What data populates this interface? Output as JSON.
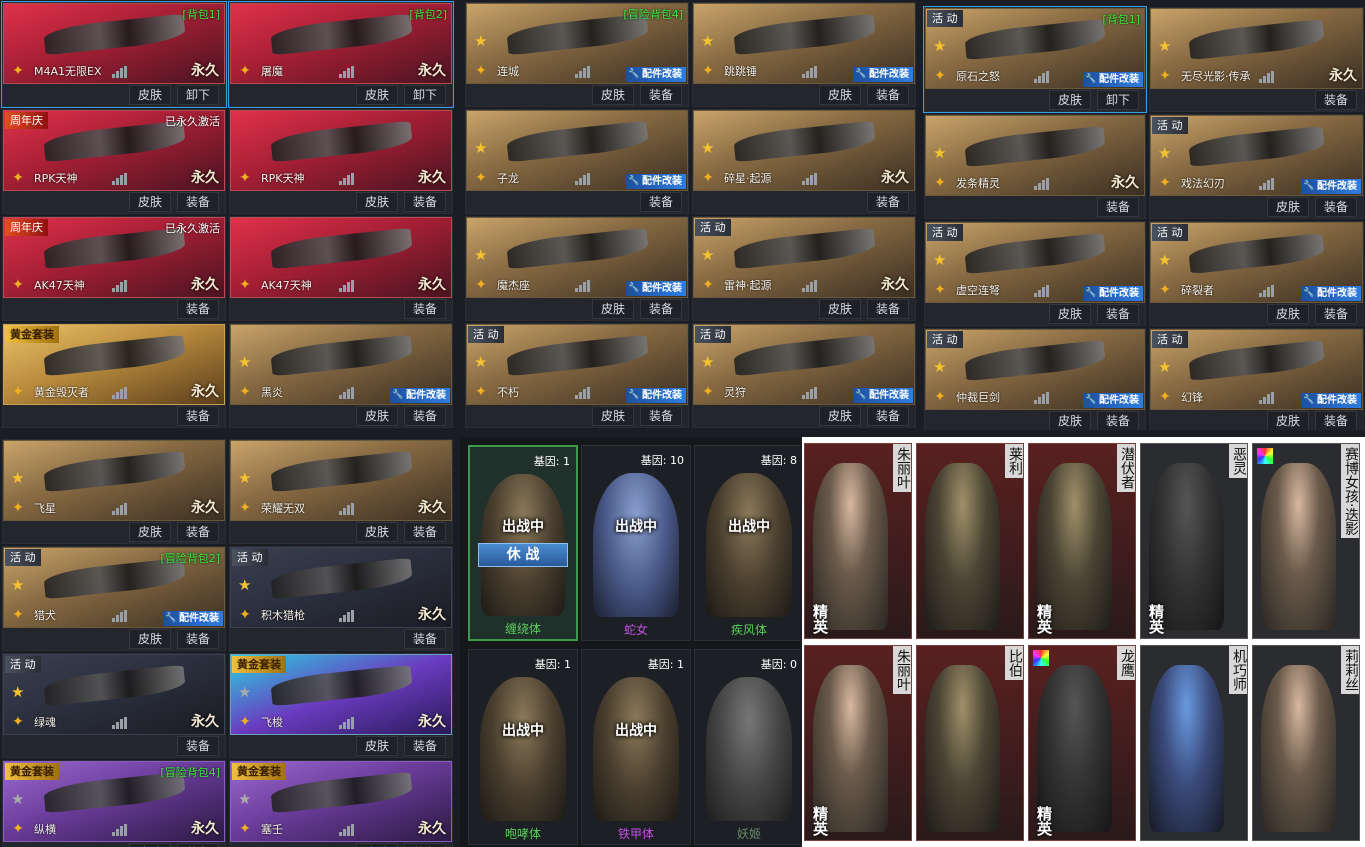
{
  "panel_a": {
    "cards": [
      {
        "name": "M4A1无限EX",
        "tr": "[背包1]",
        "tr_white": false,
        "tl": "",
        "theme": "red",
        "star": false,
        "perm": "永久",
        "mod": false,
        "btns": [
          "皮肤",
          "卸下"
        ],
        "sel": true
      },
      {
        "name": "屠魔",
        "tr": "[背包2]",
        "tr_white": false,
        "tl": "",
        "theme": "red",
        "star": false,
        "perm": "永久",
        "mod": false,
        "btns": [
          "皮肤",
          "卸下"
        ],
        "sel": true
      },
      {
        "name": "RPK天神",
        "tr": "已永久激活",
        "tr_white": true,
        "tl": "周年庆",
        "tl_kind": "anniv",
        "theme": "red",
        "star": false,
        "perm": "永久",
        "mod": false,
        "btns": [
          "皮肤",
          "装备"
        ]
      },
      {
        "name": "RPK天神",
        "tr": "",
        "tl": "",
        "theme": "red",
        "star": false,
        "perm": "永久",
        "mod": false,
        "btns": [
          "皮肤",
          "装备"
        ]
      },
      {
        "name": "AK47天神",
        "tr": "已永久激活",
        "tr_white": true,
        "tl": "周年庆",
        "tl_kind": "anniv",
        "theme": "red",
        "star": false,
        "perm": "永久",
        "mod": false,
        "btns": [
          "装备"
        ]
      },
      {
        "name": "AK47天神",
        "tr": "",
        "tl": "",
        "theme": "red",
        "star": false,
        "perm": "永久",
        "mod": false,
        "btns": [
          "装备"
        ]
      },
      {
        "name": "黄金毁灭者",
        "tr": "",
        "tl": "黄金套装",
        "tl_kind": "gold",
        "theme": "gold",
        "star": false,
        "perm": "永久",
        "mod": false,
        "btns": [
          "装备"
        ]
      },
      {
        "name": "黑炎",
        "tr": "",
        "tl": "",
        "theme": "",
        "star": true,
        "perm": "",
        "mod": true,
        "btns": [
          "皮肤",
          "装备"
        ]
      }
    ]
  },
  "panel_b": {
    "cards": [
      {
        "name": "连城",
        "tr": "[冒险背包4]",
        "tl": "",
        "theme": "",
        "star": true,
        "perm": "",
        "mod": true,
        "btns": [
          "皮肤",
          "装备"
        ]
      },
      {
        "name": "跳跳锤",
        "tr": "",
        "tl": "",
        "theme": "",
        "star": true,
        "perm": "",
        "mod": true,
        "btns": [
          "皮肤",
          "装备"
        ]
      },
      {
        "name": "子龙",
        "tr": "",
        "tl": "",
        "theme": "",
        "star": true,
        "perm": "",
        "mod": true,
        "btns": [
          "装备"
        ]
      },
      {
        "name": "碎星·起源",
        "tr": "",
        "tl": "",
        "theme": "",
        "star": true,
        "perm": "永久",
        "mod": false,
        "btns": [
          "装备"
        ]
      },
      {
        "name": "魔杰座",
        "tr": "",
        "tl": "",
        "theme": "",
        "star": true,
        "perm": "",
        "mod": true,
        "btns": [
          "皮肤",
          "装备"
        ]
      },
      {
        "name": "雷神·起源",
        "tr": "",
        "tl": "活 动",
        "tl_kind": "event",
        "theme": "",
        "star": true,
        "perm": "永久",
        "mod": false,
        "btns": [
          "皮肤",
          "装备"
        ]
      },
      {
        "name": "不朽",
        "tr": "",
        "tl": "活 动",
        "tl_kind": "event",
        "theme": "",
        "star": true,
        "perm": "",
        "mod": true,
        "btns": [
          "皮肤",
          "装备"
        ]
      },
      {
        "name": "灵狩",
        "tr": "",
        "tl": "活 动",
        "tl_kind": "event",
        "theme": "",
        "star": true,
        "perm": "",
        "mod": true,
        "btns": [
          "皮肤",
          "装备"
        ]
      }
    ]
  },
  "panel_c": {
    "cards": [
      {
        "name": "原石之怒",
        "tr": "[背包1]",
        "tl": "活 动",
        "tl_kind": "event",
        "theme": "",
        "star": true,
        "perm": "",
        "mod": true,
        "btns": [
          "皮肤",
          "卸下"
        ],
        "sel": true
      },
      {
        "name": "无尽光影·传承",
        "tr": "",
        "tl": "",
        "theme": "",
        "star": true,
        "perm": "永久",
        "mod": false,
        "btns": [
          "装备"
        ]
      },
      {
        "name": "发条精灵",
        "tr": "",
        "tl": "",
        "theme": "",
        "star": true,
        "perm": "永久",
        "mod": false,
        "btns": [
          "装备"
        ]
      },
      {
        "name": "戏法幻刃",
        "tr": "",
        "tl": "活 动",
        "tl_kind": "event",
        "theme": "",
        "star": true,
        "perm": "",
        "mod": true,
        "btns": [
          "皮肤",
          "装备"
        ]
      },
      {
        "name": "虚空连弩",
        "tr": "",
        "tl": "活 动",
        "tl_kind": "event",
        "theme": "",
        "star": true,
        "perm": "",
        "mod": true,
        "btns": [
          "皮肤",
          "装备"
        ]
      },
      {
        "name": "碎裂者",
        "tr": "",
        "tl": "活 动",
        "tl_kind": "event",
        "theme": "",
        "star": true,
        "perm": "",
        "mod": true,
        "btns": [
          "皮肤",
          "装备"
        ]
      },
      {
        "name": "仲裁巨剑",
        "tr": "",
        "tl": "活 动",
        "tl_kind": "event",
        "theme": "",
        "star": true,
        "perm": "",
        "mod": true,
        "btns": [
          "皮肤",
          "装备"
        ]
      },
      {
        "name": "幻锋",
        "tr": "",
        "tl": "活 动",
        "tl_kind": "event",
        "theme": "",
        "star": true,
        "perm": "",
        "mod": true,
        "btns": [
          "皮肤",
          "装备"
        ]
      }
    ]
  },
  "panel_d": {
    "cards": [
      {
        "name": "飞星",
        "tr": "",
        "tl": "",
        "theme": "",
        "star": true,
        "perm": "永久",
        "mod": false,
        "btns": [
          "皮肤",
          "装备"
        ]
      },
      {
        "name": "荣耀无双",
        "tr": "",
        "tl": "",
        "theme": "",
        "star": true,
        "perm": "永久",
        "mod": false,
        "btns": [
          "皮肤",
          "装备"
        ]
      },
      {
        "name": "猎犬",
        "tr": "[冒险背包2]",
        "tl": "活 动",
        "tl_kind": "event",
        "theme": "",
        "star": true,
        "perm": "",
        "mod": true,
        "btns": [
          "皮肤",
          "装备"
        ]
      },
      {
        "name": "积木猎枪",
        "tr": "",
        "tl": "活 动",
        "tl_kind": "event",
        "theme": "dark",
        "star": true,
        "perm": "永久",
        "mod": false,
        "btns": [
          "装备"
        ]
      },
      {
        "name": "绿魂",
        "tr": "",
        "tl": "活 动",
        "tl_kind": "event",
        "theme": "dark",
        "star": true,
        "perm": "永久",
        "mod": false,
        "btns": [
          "装备"
        ]
      },
      {
        "name": "飞梭",
        "tr": "",
        "tl": "黄金套装",
        "tl_kind": "gold",
        "theme": "cyan",
        "star": true,
        "star_grey": true,
        "perm": "永久",
        "mod": false,
        "btns": [
          "皮肤",
          "装备"
        ]
      },
      {
        "name": "纵横",
        "tr": "[冒险背包4]",
        "tl": "黄金套装",
        "tl_kind": "gold",
        "theme": "purple",
        "star": true,
        "star_grey": true,
        "perm": "永久",
        "mod": false,
        "btns": [
          "皮肤",
          "装备"
        ]
      },
      {
        "name": "塞壬",
        "tr": "",
        "tl": "黄金套装",
        "tl_kind": "gold",
        "theme": "purple",
        "star": true,
        "star_grey": true,
        "perm": "永久",
        "mod": false,
        "btns": [
          "皮肤",
          "装备"
        ]
      }
    ]
  },
  "zombies": [
    {
      "name": "缠绕体",
      "gene": "基因: 1",
      "battle": "出战中",
      "rest": "休 战",
      "active": true,
      "fig": "",
      "name_color": ""
    },
    {
      "name": "蛇女",
      "gene": "基因: 10",
      "battle": "出战中",
      "rest": "",
      "active": false,
      "fig": "blue",
      "name_color": "purple"
    },
    {
      "name": "疾风体",
      "gene": "基因: 8",
      "battle": "出战中",
      "rest": "",
      "active": false,
      "fig": "",
      "name_color": ""
    },
    {
      "name": "咆哮体",
      "gene": "基因: 1",
      "battle": "出战中",
      "rest": "",
      "active": false,
      "fig": "",
      "name_color": ""
    },
    {
      "name": "铁甲体",
      "gene": "基因: 1",
      "battle": "出战中",
      "rest": "",
      "active": false,
      "fig": "",
      "name_color": "purple"
    },
    {
      "name": "妖姬",
      "gene": "基因: 0",
      "battle": "",
      "rest": "",
      "active": false,
      "fig": "grey",
      "name_color": "dim"
    }
  ],
  "characters": [
    {
      "name": "朱丽叶",
      "elite": "精英",
      "rainbow": false,
      "fig": "",
      "red": true
    },
    {
      "name": "莱利",
      "elite": "",
      "rainbow": false,
      "fig": "soldier",
      "red": true
    },
    {
      "name": "潜伏者",
      "elite": "精英",
      "rainbow": false,
      "fig": "soldier",
      "red": true
    },
    {
      "name": "恶灵",
      "elite": "精英",
      "rainbow": false,
      "fig": "mask",
      "red": false
    },
    {
      "name": "赛博女孩·迭影",
      "elite": "",
      "rainbow": true,
      "fig": "",
      "red": false
    },
    {
      "name": "朱丽叶",
      "elite": "精英",
      "rainbow": false,
      "fig": "",
      "red": true
    },
    {
      "name": "比伯",
      "elite": "",
      "rainbow": false,
      "fig": "soldier",
      "red": true
    },
    {
      "name": "龙鹰",
      "elite": "精英",
      "rainbow": true,
      "fig": "mask",
      "red": true
    },
    {
      "name": "机巧师",
      "elite": "",
      "rainbow": false,
      "fig": "blue",
      "red": false
    },
    {
      "name": "莉莉丝",
      "elite": "",
      "rainbow": false,
      "fig": "",
      "red": false
    }
  ],
  "mod_label": "配件改装",
  "colors": {
    "accent_green": "#3ee63e",
    "star": "#f4c430",
    "mod_blue": "#2f7de0",
    "select": "#3aa0e0"
  }
}
